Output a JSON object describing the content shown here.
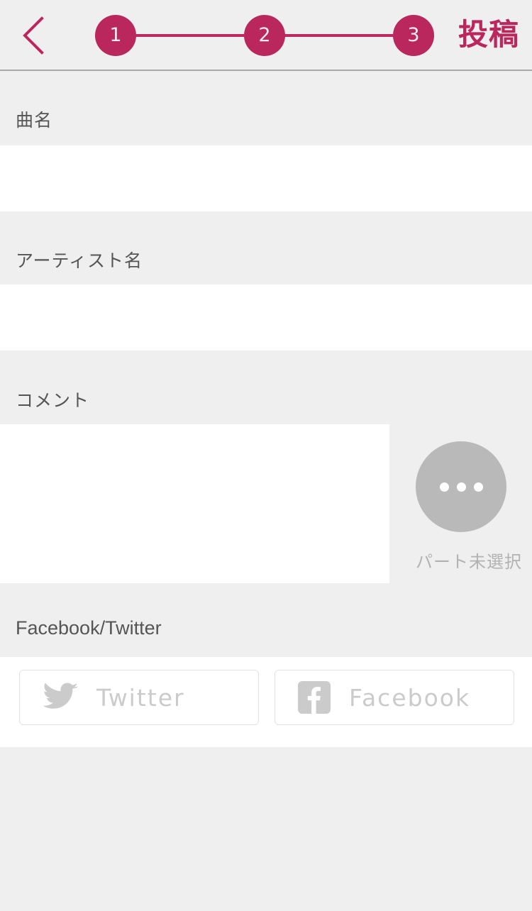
{
  "header": {
    "back_icon": "chevron-left-icon",
    "title": "投稿",
    "accent_color": "#bb275d",
    "steps": [
      {
        "number": "1",
        "active": true
      },
      {
        "number": "2",
        "active": true
      },
      {
        "number": "3",
        "active": true
      }
    ]
  },
  "form": {
    "song_title": {
      "label": "曲名",
      "value": "",
      "placeholder": ""
    },
    "artist_name": {
      "label": "アーティスト名",
      "value": "",
      "placeholder": ""
    },
    "comment": {
      "label": "コメント",
      "value": "",
      "placeholder": ""
    },
    "part_selector": {
      "icon": "ellipsis-icon",
      "label": "パート未選択",
      "circle_color": "#b9b9b9"
    },
    "social": {
      "label": "Facebook/Twitter",
      "buttons": [
        {
          "icon": "twitter-bird-icon",
          "label": "Twitter"
        },
        {
          "icon": "facebook-f-icon",
          "label": "Facebook"
        }
      ]
    }
  }
}
